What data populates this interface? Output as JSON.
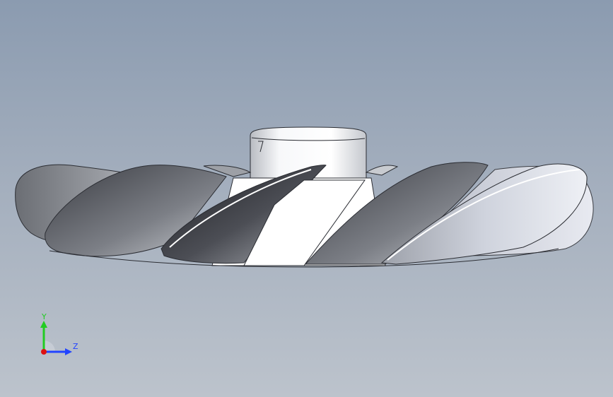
{
  "viewport": {
    "background_top": "#8b9bb0",
    "background_bottom": "#bcc3cc"
  },
  "model": {
    "icon": "impeller-3d-model",
    "highlight_color": "#ffffff",
    "shade_dark": "#2b2d33",
    "shade_light": "#e6e9ee"
  },
  "triad": {
    "y_label": "Y",
    "z_label": "Z",
    "y_color": "#22cc22",
    "z_color": "#2244ff",
    "x_color": "#dd1111"
  }
}
